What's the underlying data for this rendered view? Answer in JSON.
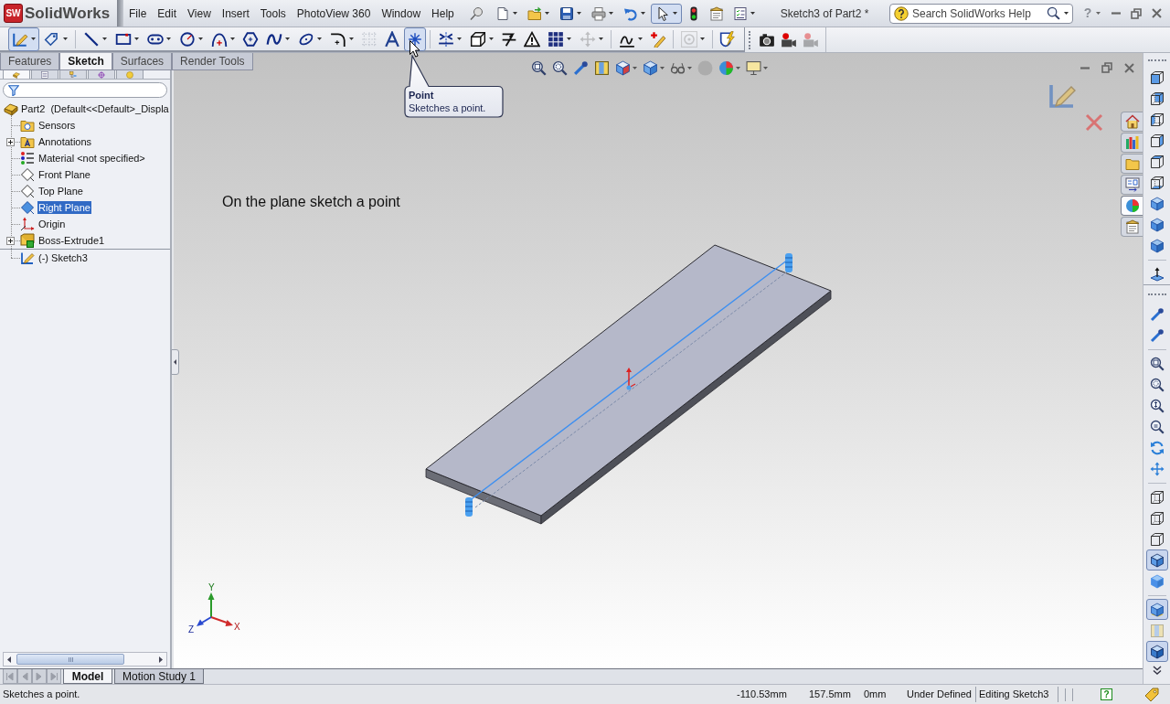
{
  "app": {
    "badge": "SW",
    "name": "SolidWorks"
  },
  "menu": [
    "File",
    "Edit",
    "View",
    "Insert",
    "Tools",
    "PhotoView 360",
    "Window",
    "Help"
  ],
  "quick_access": [
    {
      "kind": "new",
      "selected": false
    },
    {
      "kind": "open",
      "selected": false
    },
    {
      "kind": "save",
      "selected": false
    },
    {
      "kind": "print",
      "selected": false
    },
    {
      "kind": "undo",
      "selected": false
    },
    {
      "kind": "select",
      "selected": true
    },
    {
      "kind": "rebuild",
      "selected": false
    },
    {
      "kind": "options",
      "selected": false
    },
    {
      "kind": "checklist",
      "selected": false
    }
  ],
  "document_title": "Sketch3 of Part2 *",
  "search": {
    "placeholder": "Search SolidWorks Help"
  },
  "help": {
    "glyph": "?"
  },
  "command_groups": [
    {
      "tools": [
        {
          "kind": "sketch",
          "selected": true,
          "disabled": false
        },
        {
          "kind": "dimension",
          "selected": false,
          "disabled": false
        }
      ]
    },
    {
      "tools": [
        {
          "kind": "line",
          "selected": false,
          "disabled": false
        },
        {
          "kind": "rectangle",
          "selected": false,
          "disabled": false
        },
        {
          "kind": "slot",
          "selected": false,
          "disabled": false
        },
        {
          "kind": "circle",
          "selected": false,
          "disabled": false
        },
        {
          "kind": "arc",
          "selected": false,
          "disabled": false
        },
        {
          "kind": "polygon",
          "selected": false,
          "disabled": false
        },
        {
          "kind": "spline",
          "selected": false,
          "disabled": false
        },
        {
          "kind": "ellipse",
          "selected": false,
          "disabled": false
        },
        {
          "kind": "fillet",
          "selected": false,
          "disabled": false
        },
        {
          "kind": "construction",
          "selected": false,
          "disabled": true
        },
        {
          "kind": "text",
          "selected": false,
          "disabled": false
        },
        {
          "kind": "point",
          "selected": true,
          "disabled": false
        }
      ]
    },
    {
      "tools": [
        {
          "kind": "mirror",
          "selected": false,
          "disabled": false
        },
        {
          "kind": "convert",
          "selected": false,
          "disabled": false
        },
        {
          "kind": "trim",
          "selected": false,
          "disabled": false
        },
        {
          "kind": "relations",
          "selected": false,
          "disabled": false
        },
        {
          "kind": "pattern",
          "selected": false,
          "disabled": false
        },
        {
          "kind": "move",
          "selected": false,
          "disabled": true
        }
      ]
    },
    {
      "tools": [
        {
          "kind": "repair",
          "selected": false,
          "disabled": false
        },
        {
          "kind": "quick-snaps",
          "selected": false,
          "disabled": false
        }
      ]
    },
    {
      "tools": [
        {
          "kind": "shaded-sketch",
          "selected": false,
          "disabled": true
        }
      ]
    },
    {
      "tools": [
        {
          "kind": "rapid-sketch",
          "selected": false,
          "disabled": false
        }
      ]
    }
  ],
  "capture_tools": [
    {
      "kind": "camera",
      "disabled": false
    },
    {
      "kind": "record",
      "disabled": false
    },
    {
      "kind": "record",
      "disabled": true
    }
  ],
  "command_tabs": [
    {
      "label": "Features",
      "selected": false
    },
    {
      "label": "Sketch",
      "selected": true
    },
    {
      "label": "Surfaces",
      "selected": false
    },
    {
      "label": "Render Tools",
      "selected": false
    }
  ],
  "panel_tabs": [
    {
      "kind": "feature-manager",
      "selected": true
    },
    {
      "kind": "property-manager",
      "selected": false
    },
    {
      "kind": "configuration-manager",
      "selected": false
    },
    {
      "kind": "dimxpert-manager",
      "selected": false
    },
    {
      "kind": "display-manager",
      "selected": false
    }
  ],
  "feature_tree": {
    "root": {
      "label": "Part2  (Default<<Default>_Displa",
      "kind": "part",
      "selected": false,
      "children": [
        {
          "label": "Sensors",
          "kind": "sensors",
          "selected": false
        },
        {
          "label": "Annotations",
          "kind": "annotations",
          "selected": false,
          "expanded": false
        },
        {
          "label": "Material <not specified>",
          "kind": "material",
          "selected": false
        },
        {
          "label": "Front Plane",
          "kind": "plane",
          "selected": false
        },
        {
          "label": "Top Plane",
          "kind": "plane",
          "selected": false
        },
        {
          "label": "Right Plane",
          "kind": "plane",
          "selected": true
        },
        {
          "label": "Origin",
          "kind": "origin",
          "selected": false
        },
        {
          "label": "Boss-Extrude1",
          "kind": "feature",
          "selected": false,
          "expanded": false
        },
        {
          "label": "(-) Sketch3",
          "kind": "sketch",
          "selected": false
        }
      ]
    }
  },
  "heads_up_toolbar": [
    {
      "kind": "zoom-fit",
      "disabled": false
    },
    {
      "kind": "zoom-area",
      "disabled": false
    },
    {
      "kind": "previous-view",
      "disabled": false
    },
    {
      "kind": "section-view",
      "disabled": false
    },
    {
      "kind": "view-orientation",
      "disabled": false
    },
    {
      "kind": "display-style",
      "disabled": false
    },
    {
      "kind": "hide-show",
      "disabled": false
    },
    {
      "kind": "edit-appearance",
      "disabled": true
    },
    {
      "kind": "scene",
      "disabled": false
    },
    {
      "kind": "view-settings",
      "disabled": false
    }
  ],
  "tooltip": {
    "title": "Point",
    "text": "Sketches a point."
  },
  "instruction": "On the plane sketch a point",
  "triad": {
    "x": "X",
    "y": "Y",
    "z": "Z"
  },
  "task_pane_tabs": [
    {
      "kind": "home",
      "selected": false
    },
    {
      "kind": "design-library",
      "selected": false
    },
    {
      "kind": "file-explorer",
      "selected": false
    },
    {
      "kind": "view-palette",
      "selected": false
    },
    {
      "kind": "appearances",
      "selected": true
    },
    {
      "kind": "custom-properties",
      "selected": false
    }
  ],
  "view_toolbars": [
    {
      "groups": [
        {
          "tools": [
            {
              "kind": "view-front",
              "selected": false,
              "disabled": false
            },
            {
              "kind": "view-back",
              "selected": false,
              "disabled": false
            },
            {
              "kind": "view-left",
              "selected": false,
              "disabled": false
            },
            {
              "kind": "view-right",
              "selected": false,
              "disabled": false
            },
            {
              "kind": "view-top",
              "selected": false,
              "disabled": false
            },
            {
              "kind": "view-bottom",
              "selected": false,
              "disabled": false
            },
            {
              "kind": "view-isometric",
              "selected": false,
              "disabled": false
            },
            {
              "kind": "view-trimetric",
              "selected": false,
              "disabled": false
            },
            {
              "kind": "view-dimetric",
              "selected": false,
              "disabled": false
            }
          ]
        },
        {
          "tools": [
            {
              "kind": "normal-to",
              "selected": false,
              "disabled": false
            }
          ]
        }
      ]
    },
    {
      "groups": [
        {
          "tools": [
            {
              "kind": "previous-view",
              "selected": false,
              "disabled": false
            },
            {
              "kind": "next-view",
              "selected": false,
              "disabled": false
            }
          ]
        },
        {
          "tools": [
            {
              "kind": "zoom-fit",
              "selected": false,
              "disabled": false
            },
            {
              "kind": "zoom-area",
              "selected": false,
              "disabled": false
            },
            {
              "kind": "zoom-in-out",
              "selected": false,
              "disabled": false
            },
            {
              "kind": "zoom-selection",
              "selected": false,
              "disabled": false
            },
            {
              "kind": "rotate",
              "selected": false,
              "disabled": false
            },
            {
              "kind": "pan",
              "selected": false,
              "disabled": false
            }
          ]
        },
        {
          "tools": [
            {
              "kind": "wireframe",
              "selected": false,
              "disabled": false
            },
            {
              "kind": "hidden-visible",
              "selected": false,
              "disabled": false
            },
            {
              "kind": "hidden-removed",
              "selected": false,
              "disabled": false
            },
            {
              "kind": "shaded-edges",
              "selected": true,
              "disabled": false
            },
            {
              "kind": "shaded",
              "selected": false,
              "disabled": false
            }
          ]
        },
        {
          "tools": [
            {
              "kind": "shadows",
              "selected": true,
              "disabled": false
            },
            {
              "kind": "section-view",
              "selected": false,
              "disabled": true
            },
            {
              "kind": "perspective",
              "selected": true,
              "disabled": false
            }
          ]
        }
      ]
    }
  ],
  "bottom_tabs": [
    {
      "label": "Model",
      "selected": true
    },
    {
      "label": "Motion Study 1",
      "selected": false
    }
  ],
  "status_bar": {
    "message": "Sketches a point.",
    "coordinates": [
      "-110.53mm",
      "157.5mm",
      "0mm"
    ],
    "sketch_state": "Under Defined",
    "mode": "Editing Sketch3",
    "help_glyph": "?"
  }
}
